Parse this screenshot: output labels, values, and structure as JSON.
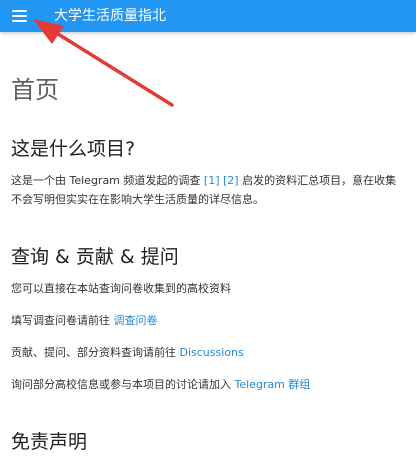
{
  "header": {
    "title": "大学生活质量指北",
    "menu_icon": "menu-icon"
  },
  "colors": {
    "header_bg": "#2196f3",
    "link": "#1e88e5",
    "arrow": "#e53935"
  },
  "main": {
    "page_title": "首页",
    "section1": {
      "heading": "这是什么项目?",
      "line1_prefix": "这是一个由 Telegram 频道发起的调查 ",
      "ref1": "[1]",
      "ref2": "[2]",
      "line1_suffix": " 启发的资料汇总项目，意在收集",
      "line2": "不会写明但实实在在影响大学生活质量的详尽信息。"
    },
    "section2": {
      "heading": "查询 & 贡献 & 提问",
      "p1": "您可以直接在本站查询问卷收集到的高校资料",
      "p2_prefix": "填写调查问卷请前往 ",
      "p2_link": "调查问卷",
      "p3_prefix": "贡献、提问、部分资料查询请前往 ",
      "p3_link": "Discussions",
      "p4_prefix": "询问部分高校信息或参与本项目的讨论请加入 ",
      "p4_link": "Telegram 群组"
    },
    "section3": {
      "heading": "免责声明"
    }
  }
}
